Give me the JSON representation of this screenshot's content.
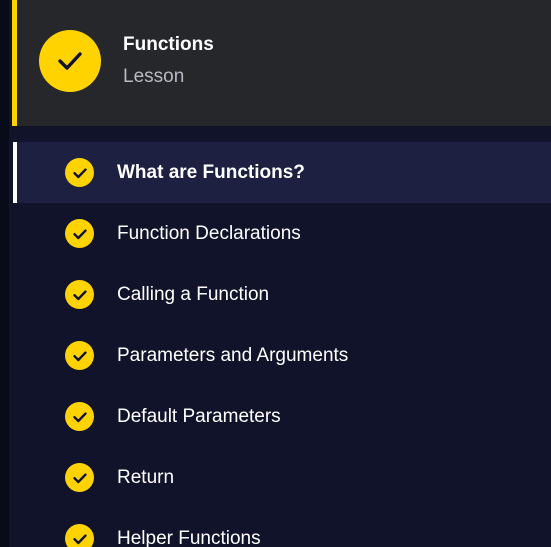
{
  "header": {
    "title": "Functions",
    "subtitle": "Lesson",
    "status_icon": "check-icon"
  },
  "lesson_items": [
    {
      "label": "What are Functions?",
      "completed": true,
      "active": true
    },
    {
      "label": "Function Declarations",
      "completed": true,
      "active": false
    },
    {
      "label": "Calling a Function",
      "completed": true,
      "active": false
    },
    {
      "label": "Parameters and Arguments",
      "completed": true,
      "active": false
    },
    {
      "label": "Default Parameters",
      "completed": true,
      "active": false
    },
    {
      "label": "Return",
      "completed": true,
      "active": false
    },
    {
      "label": "Helper Functions",
      "completed": true,
      "active": false
    }
  ],
  "colors": {
    "accent": "#ffd300",
    "background": "#11132b",
    "header_background": "#26272b",
    "active_item_background": "#1d2040",
    "text": "#ffffff",
    "subtext": "#b9b9c2"
  }
}
